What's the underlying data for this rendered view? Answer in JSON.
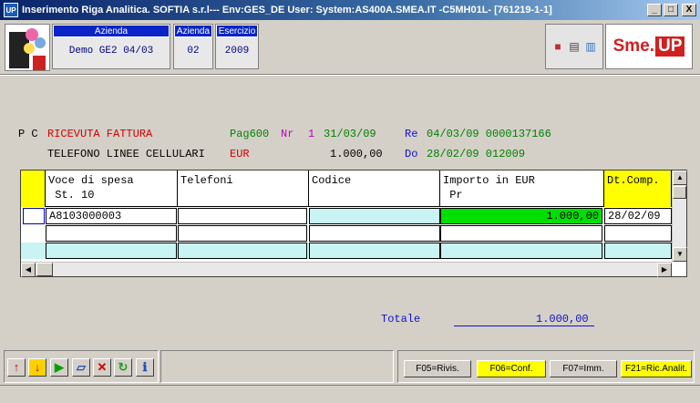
{
  "window": {
    "app_icon": "UP",
    "title": "Inserimento Riga Analitica.  SOFTIA s.r.l---  Env:GES_DE User:       System:AS400A.SMEA.IT -C5MH01L- [761219-1-1]",
    "minimize": "_",
    "maximize": "□",
    "close": "X"
  },
  "header": {
    "azienda_label": "Azienda",
    "azienda_value": "Demo GE2 04/03",
    "azienda_code_label": "Azienda",
    "azienda_code_value": "02",
    "esercizio_label": "Esercizio",
    "esercizio_value": "2009",
    "brand_sme": "Sme.",
    "brand_up": "UP",
    "icons": [
      "palette-icon",
      "notepad-icon",
      "book-icon"
    ]
  },
  "document": {
    "pc": "P C",
    "tipo": "RICEVUTA FATTURA",
    "pag": "Pag600",
    "nr_label": "Nr",
    "nr_value": "1",
    "nr_date": "31/03/09",
    "re_label": "Re",
    "re_value": "04/03/09 0000137166",
    "descrizione": "TELEFONO LINEE CELLULARI",
    "valuta": "EUR",
    "importo": "1.000,00",
    "do_label": "Do",
    "do_value": "28/02/09 012009"
  },
  "grid": {
    "columns": [
      {
        "label": "?",
        "sub": ""
      },
      {
        "label": "Voce di spesa",
        "sub": "St. 10"
      },
      {
        "label": "Telefoni",
        "sub": ""
      },
      {
        "label": "Codice",
        "sub": ""
      },
      {
        "label": "Importo in EUR",
        "sub": "Pr"
      },
      {
        "label": "Dt.Comp.",
        "sub": ""
      }
    ],
    "rows": [
      {
        "sel": "",
        "voce": "A8103000003",
        "telefoni": "",
        "codice": "",
        "importo": "1.000,00",
        "dtcomp": "28/02/09"
      },
      {
        "sel": "",
        "voce": "",
        "telefoni": "",
        "codice": "",
        "importo": "",
        "dtcomp": ""
      },
      {
        "sel": "",
        "voce": "",
        "telefoni": "",
        "codice": "",
        "importo": "",
        "dtcomp": ""
      }
    ]
  },
  "totale": {
    "label": "Totale",
    "value": "1.000,00"
  },
  "footer": {
    "nav_icons": [
      "arrow-up-icon",
      "arrow-down-icon",
      "play-icon",
      "eraser-icon",
      "delete-icon",
      "refresh-icon",
      "info-icon"
    ],
    "fkeys": [
      {
        "label": "F05=Rivis.",
        "highlight": false
      },
      {
        "label": "F06=Conf.",
        "highlight": true
      },
      {
        "label": "F07=Imm.",
        "highlight": false
      },
      {
        "label": "F21=Ric.Analit.",
        "highlight": true
      }
    ]
  },
  "colors": {
    "accent_blue": "#0a24c8",
    "title_bar": "#0a246a",
    "highlight_yellow": "#ffff00",
    "amount_green": "#00e000",
    "row_cyan": "#c8f4f4"
  }
}
